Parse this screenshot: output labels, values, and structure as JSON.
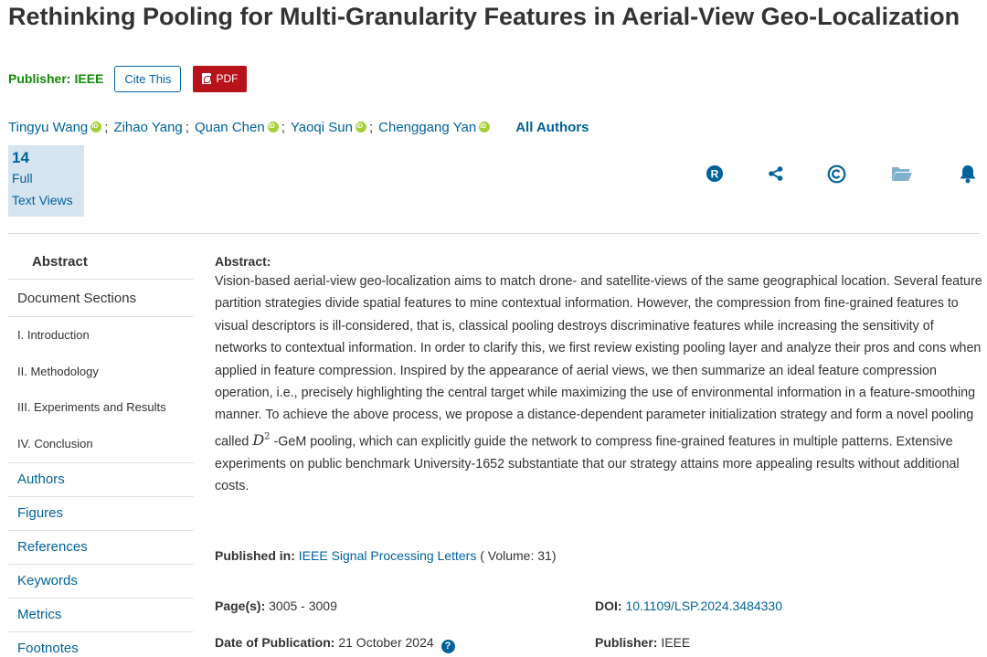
{
  "title": "Rethinking Pooling for Multi-Granularity Features in Aerial-View Geo-Localization",
  "publisher_label": "Publisher:",
  "publisher_value": "IEEE",
  "cite_label": "Cite This",
  "pdf_label": "PDF",
  "authors": [
    {
      "name": "Tingyu Wang",
      "orcid": true
    },
    {
      "name": "Zihao Yang",
      "orcid": false
    },
    {
      "name": "Quan Chen",
      "orcid": true
    },
    {
      "name": "Yaoqi Sun",
      "orcid": true
    },
    {
      "name": "Chenggang Yan",
      "orcid": true
    }
  ],
  "all_authors_label": "All Authors",
  "views": {
    "count": "14",
    "line1": "Full",
    "line2": "Text Views"
  },
  "toolbar_icons": [
    "rights-r-icon",
    "share-icon",
    "copyright-icon",
    "folder-icon",
    "bell-icon"
  ],
  "sidebar": {
    "abstract": "Abstract",
    "document_sections": "Document Sections",
    "sections": [
      "I.  Introduction",
      "II.  Methodology",
      "III.  Experiments and Results",
      "IV.  Conclusion"
    ],
    "links": [
      "Authors",
      "Figures",
      "References",
      "Keywords",
      "Metrics",
      "Footnotes"
    ]
  },
  "abstract": {
    "heading": "Abstract:",
    "text_before_math": "Vision-based aerial-view geo-localization aims to match drone- and satellite-views of the same geographical location. Several feature partition strategies divide spatial features to mine contextual information. However, the compression from fine-grained features to visual descriptors is ill-considered, that is, classical pooling destroys discriminative features while increasing the sensitivity of networks to contextual information. In order to clarify this, we first review existing pooling layer and analyze their pros and cons when applied in feature compression. Inspired by the appearance of aerial views, we then summarize an ideal feature compression operation, i.e., precisely highlighting the central target while maximizing the use of environmental information in a feature-smoothing manner. To achieve the above process, we propose a distance-dependent parameter initialization strategy and form a novel pooling called ",
    "math_base": "D",
    "math_sup": "2",
    "text_after_math": " -GeM pooling, which can explicitly guide the network to compress fine-grained features in multiple patterns. Extensive experiments on public benchmark University-1652 substantiate that our strategy attains more appealing results without additional costs."
  },
  "published_in": {
    "label": "Published in:",
    "journal": "IEEE Signal Processing Letters",
    "volume": "( Volume: 31)"
  },
  "meta": {
    "pages_label": "Page(s):",
    "pages_value": "3005 - 3009",
    "date_label": "Date of Publication:",
    "date_value": "21 October 2024",
    "doi_label": "DOI:",
    "doi_value": "10.1109/LSP.2024.3484330",
    "publisher_label": "Publisher:",
    "publisher_value": "IEEE"
  },
  "colors": {
    "accent": "#00629b",
    "publisher_green": "#138808",
    "pdf_red": "#b8131b",
    "orcid_green": "#a6ce39",
    "views_bg": "#d5e4ef"
  }
}
